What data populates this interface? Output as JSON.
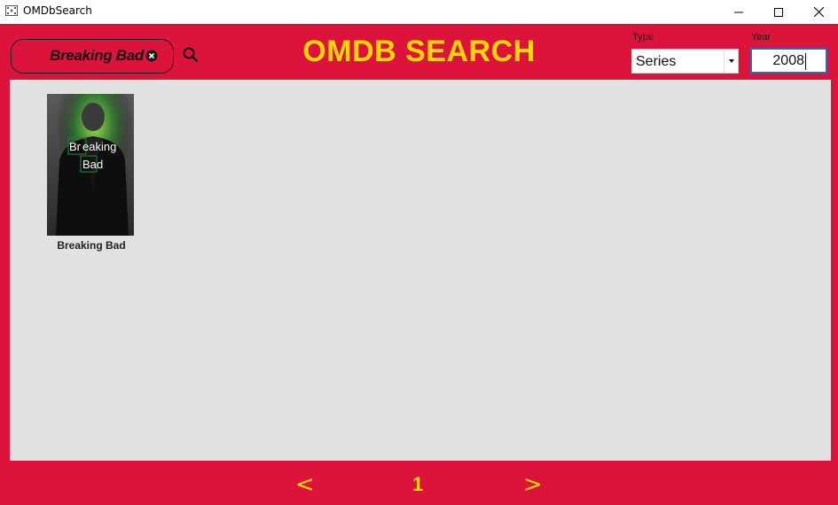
{
  "window": {
    "title": "OMDbSearch",
    "icons": {
      "app": "film-icon",
      "minimize": "minimize-icon",
      "maximize": "maximize-icon",
      "close": "close-icon"
    }
  },
  "header": {
    "search": {
      "value": "Breaking Bad",
      "clear_icon": "clear-circle-icon",
      "search_icon": "search-icon"
    },
    "heading": "OMDB SEARCH",
    "type_filter": {
      "label": "Type",
      "selected": "Series"
    },
    "year_filter": {
      "label": "Year",
      "value": "2008"
    }
  },
  "results": [
    {
      "title": "Breaking Bad",
      "poster_text": [
        "Br",
        "eaking",
        "Ba",
        "d"
      ]
    }
  ],
  "pager": {
    "prev": "<",
    "page": "1",
    "next": ">"
  },
  "colors": {
    "accent": "#dc143c",
    "heading": "#ffd700",
    "panel": "#e1e1e1"
  }
}
